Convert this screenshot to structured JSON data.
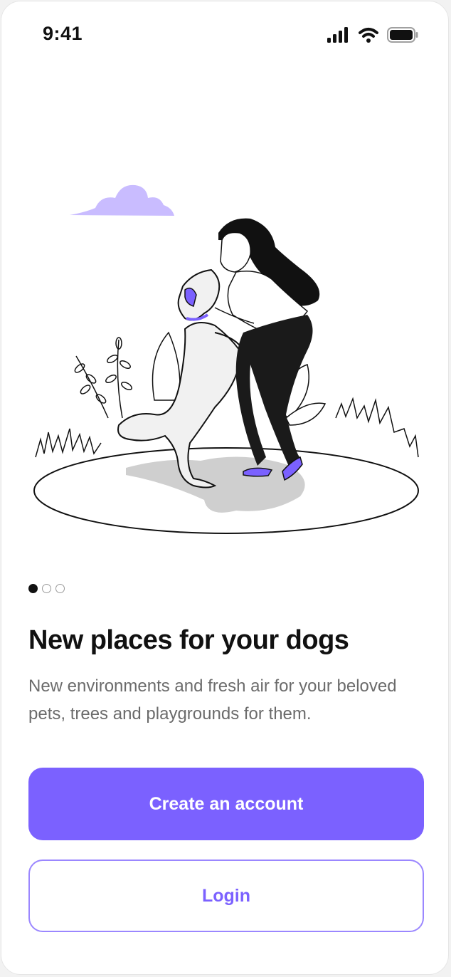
{
  "status_bar": {
    "time": "9:41",
    "icons": [
      "signal-icon",
      "wifi-icon",
      "battery-icon"
    ]
  },
  "onboarding": {
    "illustration": "woman-hugging-dog-illustration",
    "pager": {
      "total": 3,
      "current": 1
    },
    "title": "New places for your dogs",
    "description": "New environments and fresh air for your beloved pets, trees and playgrounds for them."
  },
  "actions": {
    "create_account_label": "Create an account",
    "login_label": "Login"
  },
  "colors": {
    "accent": "#7b61ff",
    "accent_light": "#c9bcff",
    "text_primary": "#111111",
    "text_secondary": "#6b6b6b"
  }
}
